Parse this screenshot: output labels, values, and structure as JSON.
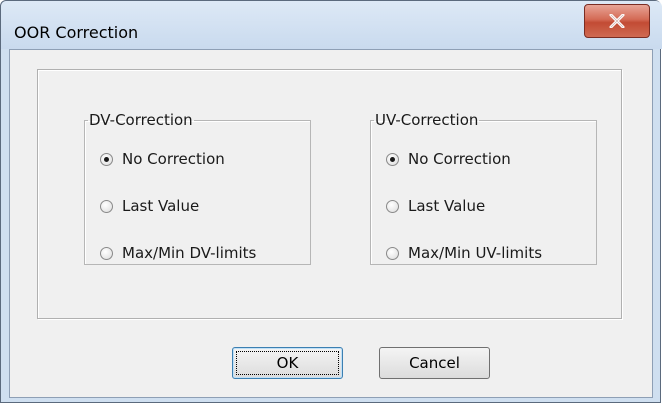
{
  "window": {
    "title": "OOR Correction"
  },
  "dv_group": {
    "title": "DV-Correction",
    "options": [
      "No Correction",
      "Last Value",
      "Max/Min DV-limits"
    ],
    "selected": "No Correction"
  },
  "uv_group": {
    "title": "UV-Correction",
    "options": [
      "No Correction",
      "Last Value",
      "Max/Min UV-limits"
    ],
    "selected": "No Correction"
  },
  "buttons": {
    "ok": "OK",
    "cancel": "Cancel"
  },
  "colors": {
    "close_button": "#c94f38",
    "window_frame": "#cfdff0",
    "dialog_bg": "#f0f0f0"
  },
  "icons": {
    "close": "close-icon",
    "radio": "radio-icon"
  }
}
